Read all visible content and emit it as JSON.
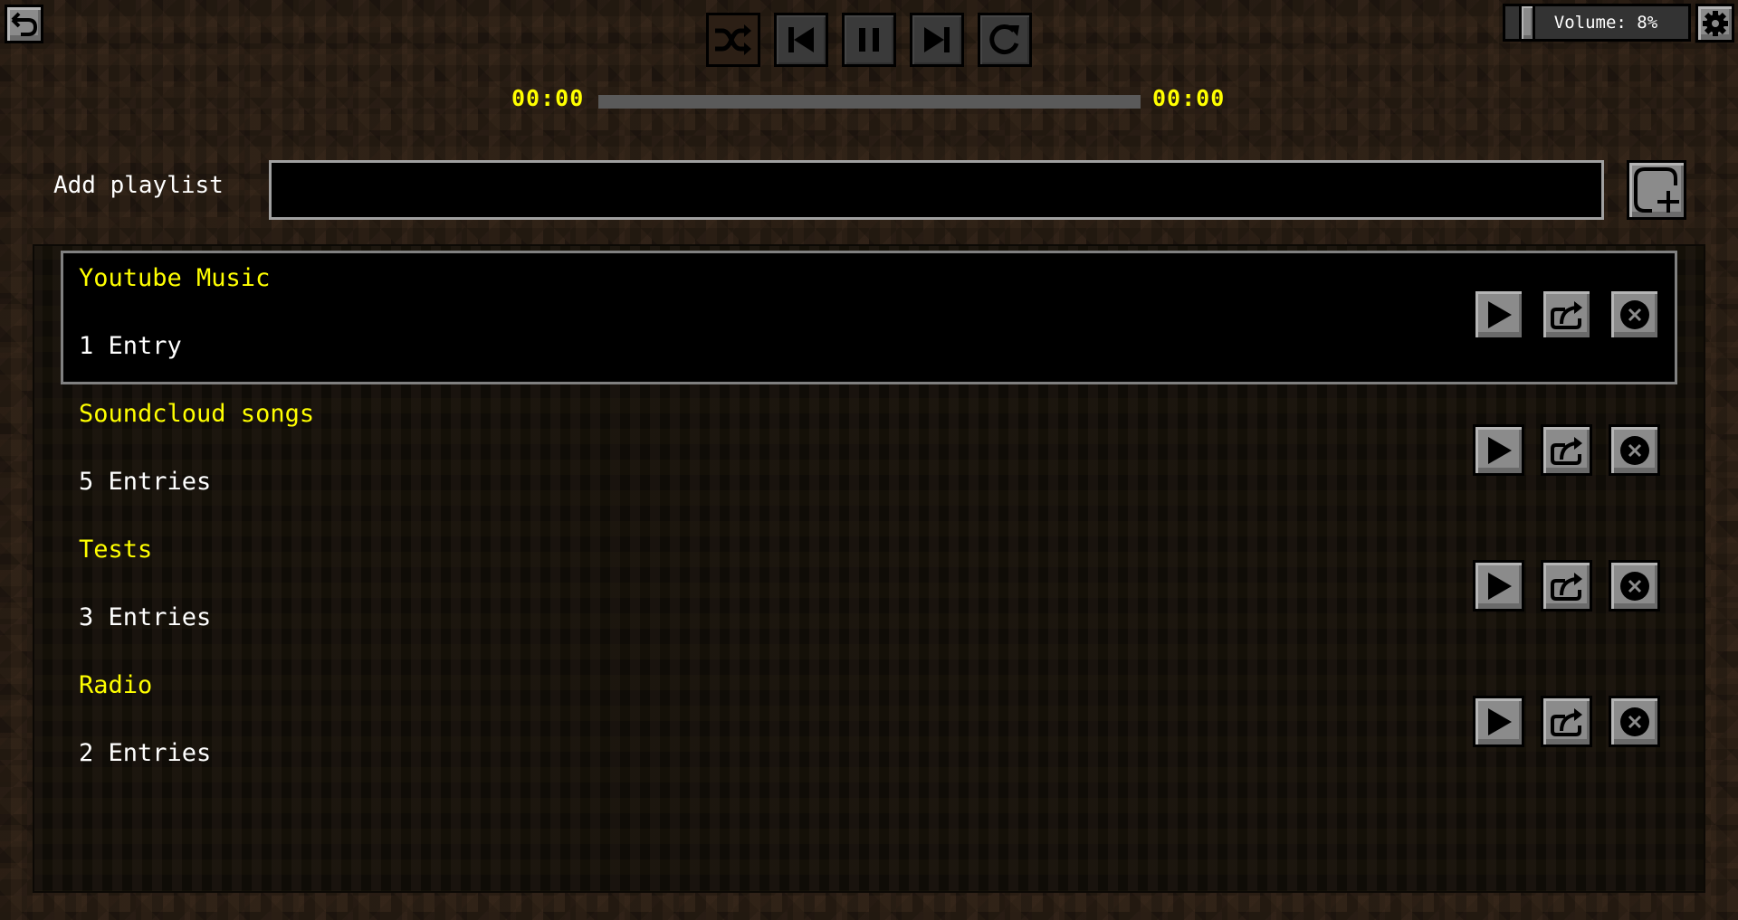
{
  "toolbar": {
    "back": {
      "icon": "back-arrow-icon"
    },
    "transport": [
      {
        "id": "shuffle",
        "icon": "shuffle-icon",
        "active": false
      },
      {
        "id": "previous",
        "icon": "skip-previous-icon",
        "active": true
      },
      {
        "id": "pause",
        "icon": "pause-icon",
        "active": true
      },
      {
        "id": "next",
        "icon": "skip-next-icon",
        "active": true
      },
      {
        "id": "repeat",
        "icon": "repeat-icon",
        "active": true
      }
    ],
    "time_elapsed": "00:00",
    "time_total": "00:00",
    "progress_percent": 0
  },
  "volume": {
    "label": "Volume: 8%",
    "value_percent": 8
  },
  "settings": {
    "icon": "gear-icon"
  },
  "add_playlist": {
    "label": "Add playlist",
    "input_value": "",
    "placeholder": "",
    "button_icon": "add-playlist-icon"
  },
  "playlists": [
    {
      "name": "Youtube Music",
      "count": "1 Entry",
      "selected": true
    },
    {
      "name": "Soundcloud songs",
      "count": "5 Entries",
      "selected": false
    },
    {
      "name": "Tests",
      "count": "3 Entries",
      "selected": false
    },
    {
      "name": "Radio",
      "count": "2 Entries",
      "selected": false
    }
  ],
  "row_actions": {
    "play_icon": "play-icon",
    "share_icon": "share-icon",
    "delete_icon": "delete-icon"
  },
  "colors": {
    "title_yellow": "#ffff00",
    "time_yellow": "#ffff00",
    "text_white": "#ffffff",
    "button_gray": "#8b8b8b",
    "selection_border": "#808080"
  }
}
